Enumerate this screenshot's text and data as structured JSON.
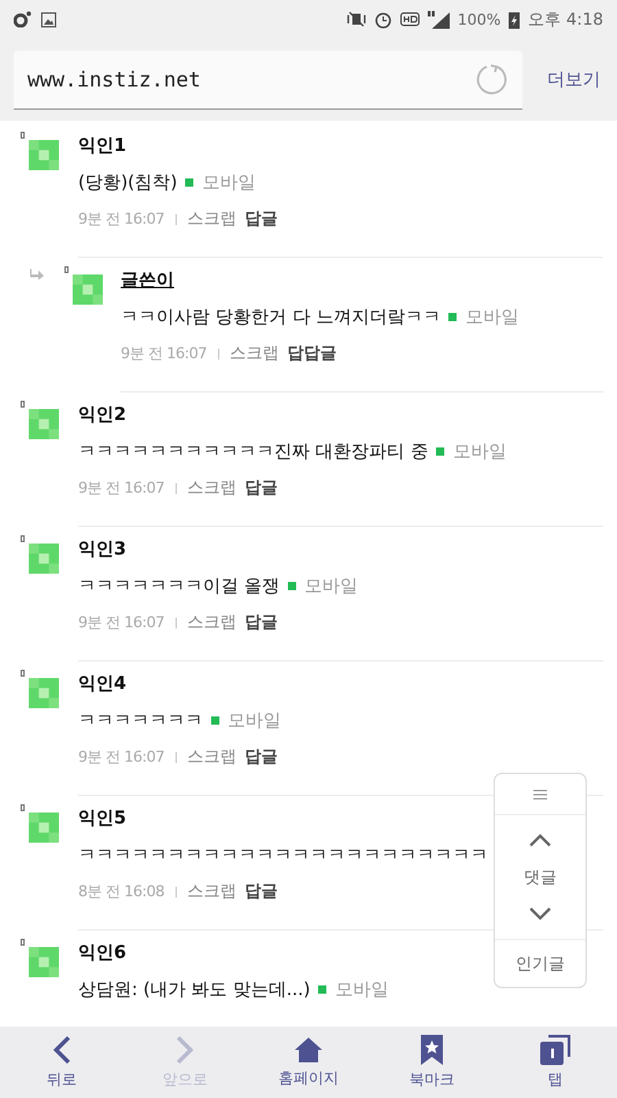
{
  "status_bar": {
    "battery": "100%",
    "time": "오후 4:18"
  },
  "address_bar": {
    "url": "www.instiz.net",
    "more": "더보기"
  },
  "comments": [
    {
      "author": "익인1",
      "is_writer": false,
      "text": "(당황)(침착)",
      "device": "모바일",
      "time": "9분 전 16:07",
      "scrap": "스크랩",
      "reply": "답글",
      "children": [
        {
          "author": "글쓴이",
          "is_writer": true,
          "text": "ㅋㅋ이사람 당황한거 다 느껴지더랔ㅋㅋ",
          "device": "모바일",
          "time": "9분 전 16:07",
          "scrap": "스크랩",
          "reply": "답답글"
        }
      ]
    },
    {
      "author": "익인2",
      "is_writer": false,
      "text": "ㅋㅋㅋㅋㅋㅋㅋㅋㅋㅋㅋ진짜 대환장파티 중",
      "device": "모바일",
      "time": "9분 전 16:07",
      "scrap": "스크랩",
      "reply": "답글"
    },
    {
      "author": "익인3",
      "is_writer": false,
      "text": "ㅋㅋㅋㅋㅋㅋㅋ이걸 올쟁",
      "device": "모바일",
      "time": "9분 전 16:07",
      "scrap": "스크랩",
      "reply": "답글"
    },
    {
      "author": "익인4",
      "is_writer": false,
      "text": "ㅋㅋㅋㅋㅋㅋㅋ",
      "device": "모바일",
      "time": "9분 전 16:07",
      "scrap": "스크랩",
      "reply": "답글"
    },
    {
      "author": "익인5",
      "is_writer": false,
      "text": "ㅋㅋㅋㅋㅋㅋㅋㅋㅋㅋㅋㅋㅋㅋㅋㅋㅋㅋㅋㅋㅋㅋㅋ",
      "time": "8분 전 16:08",
      "scrap": "스크랩",
      "reply": "답글"
    },
    {
      "author": "익인6",
      "is_writer": false,
      "text": "상담원: (내가 봐도 맞는데...)",
      "device": "모바일"
    }
  ],
  "float_panel": {
    "label": "댓글",
    "popular": "인기글"
  },
  "bottom_nav": [
    {
      "kind": "back",
      "label": "뒤로",
      "disabled": false
    },
    {
      "kind": "forward",
      "label": "앞으로",
      "disabled": true
    },
    {
      "kind": "home",
      "label": "홈페이지",
      "disabled": false
    },
    {
      "kind": "bookmark",
      "label": "북마크",
      "disabled": false
    },
    {
      "kind": "tabs",
      "label": "탭",
      "disabled": false
    }
  ]
}
